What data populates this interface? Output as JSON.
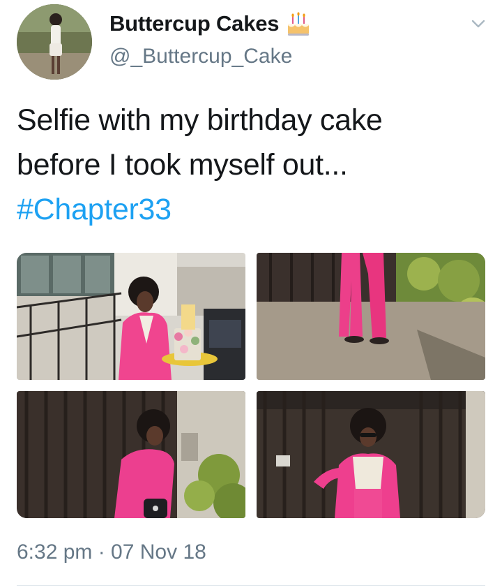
{
  "author": {
    "display_name": "Buttercup Cakes",
    "handle": "@_Buttercup_Cake",
    "emoji_icon": "birthday-cake-icon",
    "avatar_icon": "profile-avatar"
  },
  "tweet": {
    "text_lines": [
      "Selfie with my birthday cake",
      "before I took myself out..."
    ],
    "hashtag": "#Chapter33"
  },
  "media": [
    {
      "name": "photo-with-cake"
    },
    {
      "name": "photo-pink-trousers"
    },
    {
      "name": "photo-pink-suit-bag"
    },
    {
      "name": "photo-pink-suit-pose"
    }
  ],
  "meta": {
    "timestamp": "6:32 pm · 07 Nov 18"
  },
  "colors": {
    "link": "#1da1f2",
    "text": "#14171a",
    "secondary": "#657786",
    "divider": "#e1e8ed"
  }
}
